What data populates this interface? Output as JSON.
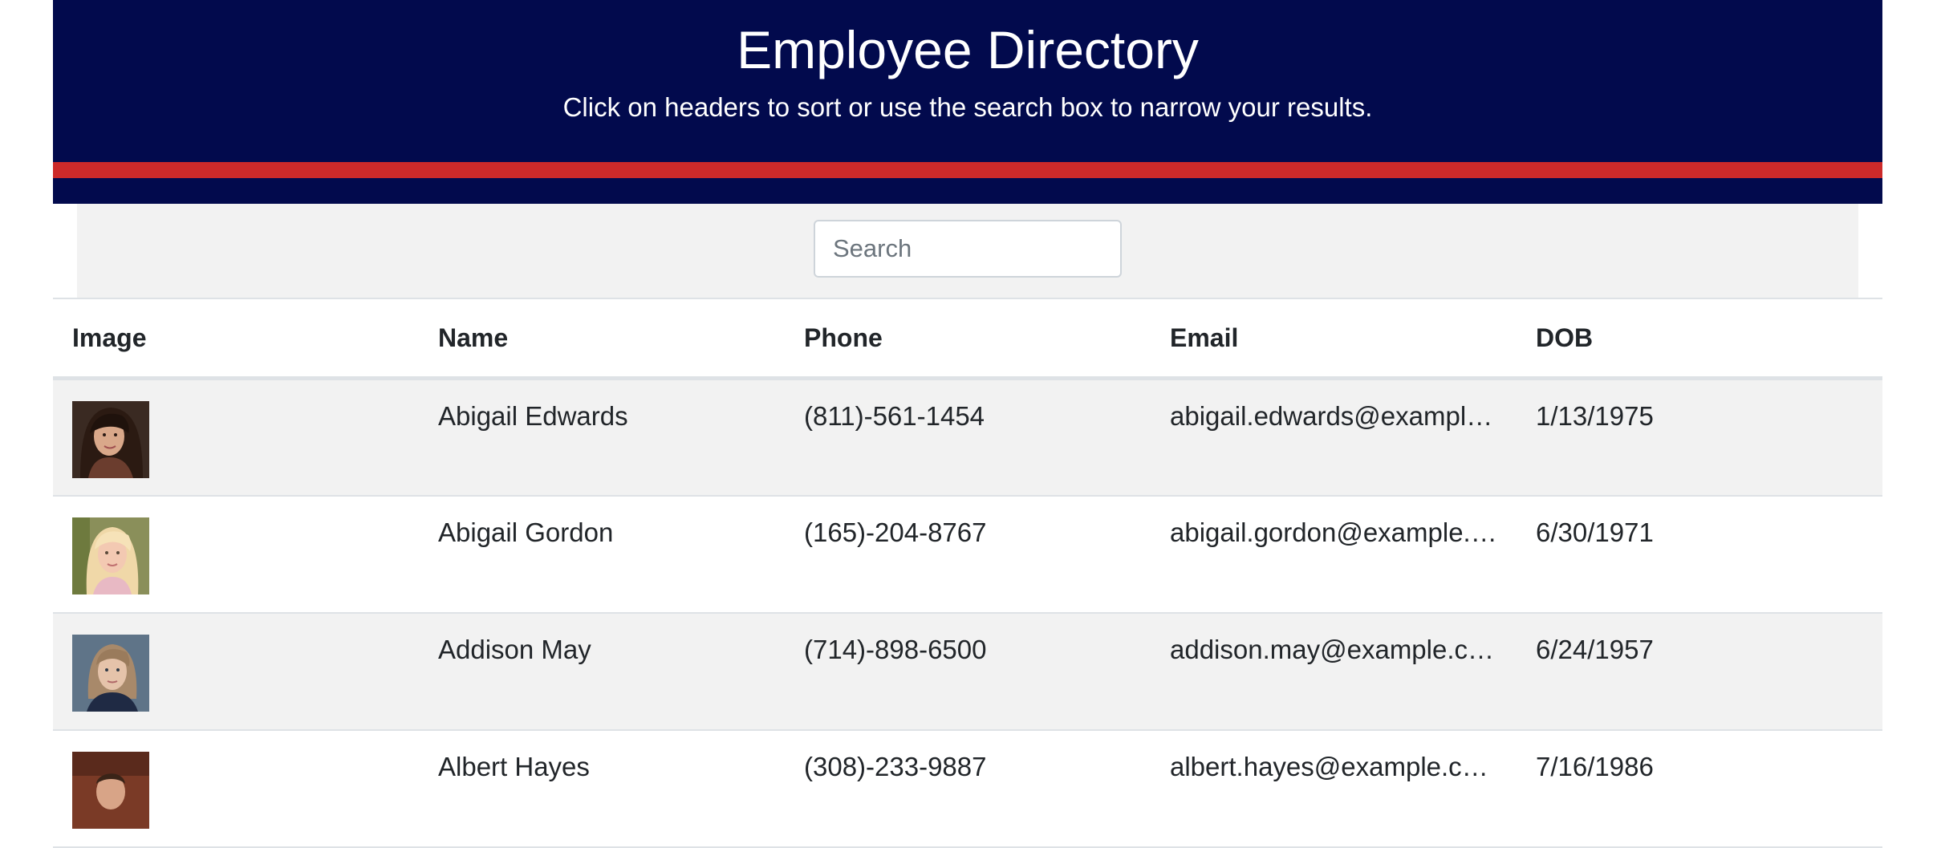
{
  "header": {
    "title": "Employee Directory",
    "subtitle": "Click on headers to sort or use the search box to narrow your results.",
    "background": "#020a4d",
    "stripe_color": "#cc2a2a"
  },
  "search": {
    "placeholder": "Search",
    "value": ""
  },
  "table": {
    "columns": [
      "Image",
      "Name",
      "Phone",
      "Email",
      "DOB"
    ],
    "rows": [
      {
        "image": "employee-photo",
        "name": "Abigail Edwards",
        "phone": "(811)-561-1454",
        "email": "abigail.edwards@example.com",
        "dob": "1/13/1975"
      },
      {
        "image": "employee-photo",
        "name": "Abigail Gordon",
        "phone": "(165)-204-8767",
        "email": "abigail.gordon@example.com",
        "dob": "6/30/1971"
      },
      {
        "image": "employee-photo",
        "name": "Addison May",
        "phone": "(714)-898-6500",
        "email": "addison.may@example.com",
        "dob": "6/24/1957"
      },
      {
        "image": "employee-photo",
        "name": "Albert Hayes",
        "phone": "(308)-233-9887",
        "email": "albert.hayes@example.com",
        "dob": "7/16/1986"
      }
    ]
  }
}
